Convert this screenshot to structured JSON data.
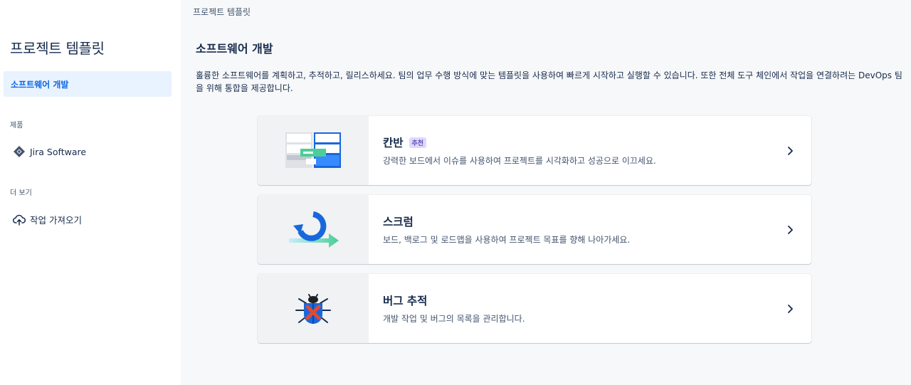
{
  "sidebar": {
    "title": "프로젝트 템플릿",
    "active_item": "소프트웨어 개발",
    "section_products": "제품",
    "product_item": "Jira Software",
    "section_more": "더 보기",
    "import_item": "작업 가져오기"
  },
  "main": {
    "breadcrumb": "프로젝트 템플릿",
    "heading": "소프트웨어 개발",
    "description": "훌륭한 소프트웨어를 계획하고, 추적하고, 릴리스하세요. 팀의 업무 수행 방식에 맞는 템플릿을 사용하여 빠르게 시작하고 실행할 수 있습니다. 또한 전체 도구 체인에서 작업을 연결하려는 DevOps 팀을 위해 통합을 제공합니다.",
    "cards": [
      {
        "title": "칸반",
        "badge": "추천",
        "desc": "강력한 보드에서 이슈를 사용하여 프로젝트를 시각화하고 성공으로 이끄세요.",
        "icon": "kanban-illustration"
      },
      {
        "title": "스크럼",
        "badge": "",
        "desc": "보드, 백로그 및 로드맵을 사용하여 프로젝트 목표를 향해 나아가세요.",
        "icon": "scrum-illustration"
      },
      {
        "title": "버그 추적",
        "badge": "",
        "desc": "개발 작업 및 버그의 목록을 관리합니다.",
        "icon": "bug-illustration"
      }
    ]
  },
  "colors": {
    "accent": "#0C66E4",
    "active_bg": "#E9F2FF",
    "main_bg": "#F7F8F9"
  }
}
